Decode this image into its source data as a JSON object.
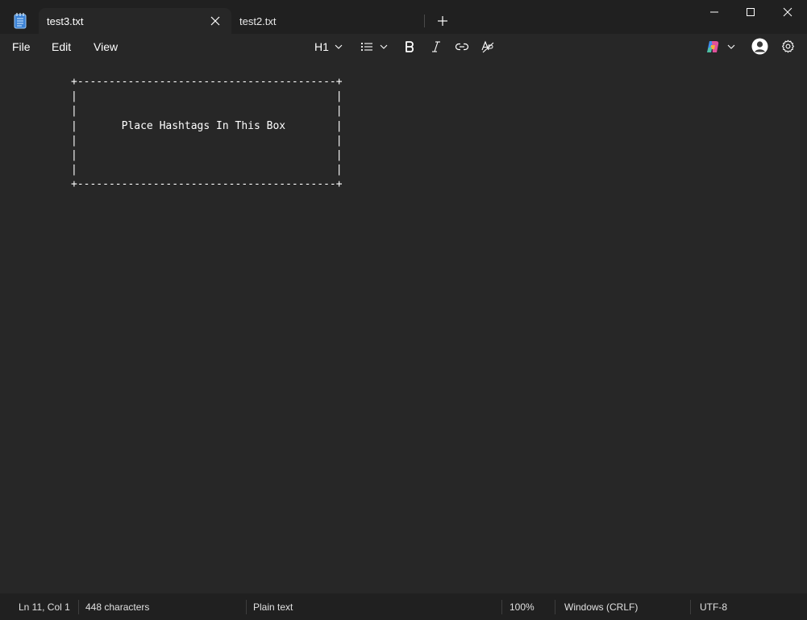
{
  "tabs": [
    {
      "label": "test3.txt",
      "active": true
    },
    {
      "label": "test2.txt",
      "active": false
    }
  ],
  "menu": {
    "file": "File",
    "edit": "Edit",
    "view": "View"
  },
  "toolbar": {
    "heading": "H1"
  },
  "document": {
    "content": "+-----------------------------------------+\n|                                         |\n|                                         |\n|       Place Hashtags In This Box        |\n|                                         |\n|                                         |\n|                                         |\n+-----------------------------------------+"
  },
  "status": {
    "position": "Ln 11, Col 1",
    "characters": "448 characters",
    "format": "Plain text",
    "zoom": "100%",
    "line_ending": "Windows (CRLF)",
    "encoding": "UTF-8"
  },
  "colors": {
    "titlebar": "#202020",
    "editor_background": "#272727",
    "notepad_icon": "#3b82d6"
  }
}
